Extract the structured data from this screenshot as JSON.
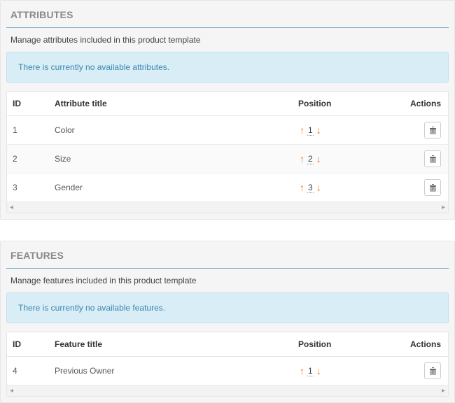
{
  "attributes": {
    "title": "ATTRIBUTES",
    "subtitle": "Manage attributes included in this product template",
    "alert": "There is currently no available attributes.",
    "headers": {
      "id": "ID",
      "title": "Attribute title",
      "position": "Position",
      "actions": "Actions"
    },
    "rows": [
      {
        "id": "1",
        "title": "Color",
        "position": "1"
      },
      {
        "id": "2",
        "title": "Size",
        "position": "2"
      },
      {
        "id": "3",
        "title": "Gender",
        "position": "3"
      }
    ]
  },
  "features": {
    "title": "FEATURES",
    "subtitle": "Manage features included in this product template",
    "alert": "There is currently no available features.",
    "headers": {
      "id": "ID",
      "title": "Feature title",
      "position": "Position",
      "actions": "Actions"
    },
    "rows": [
      {
        "id": "4",
        "title": "Previous Owner",
        "position": "1"
      }
    ]
  },
  "colors": {
    "accent": "#e67522",
    "info_bg": "#d9edf7",
    "info_fg": "#3a87ad"
  }
}
